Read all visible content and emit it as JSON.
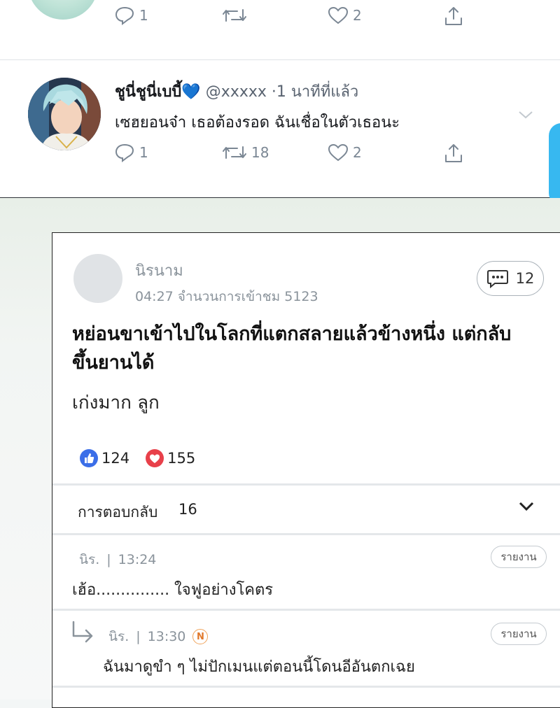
{
  "tweets": [
    {
      "actions": {
        "reply": "1",
        "retweet": "",
        "like": "2"
      }
    },
    {
      "name": "ชูนี่ชูนี่เบบี้",
      "heart": "💙",
      "meta": "@xxxxx ·1 นาทีที่แล้ว",
      "text": "เซฮยอนจ๋า เธอต้องรอด ฉันเชื่อในตัวเธอนะ",
      "actions": {
        "reply": "1",
        "retweet": "18",
        "like": "2"
      }
    }
  ],
  "post": {
    "username": "นิรนาม",
    "meta": "04:27 จำนวนการเข้าชม 5123",
    "comment_count": "12",
    "title": "หย่อนขาเข้าไปในโลกที่แตกสลายแล้วข้างหนึ่ง แต่กลับขึ้นยานได้",
    "body": "เก่งมาก ลูก",
    "likes": "124",
    "hearts": "155",
    "replies_label": "การตอบกลับ",
    "replies_count": "16"
  },
  "comments": [
    {
      "user": "นิร.",
      "sep": "|",
      "time": "13:24",
      "text": "เฮ้อ............... ใจฟูอย่างโคตร",
      "report": "รายงาน"
    },
    {
      "user": "นิร.",
      "sep": "|",
      "time": "13:30",
      "badge": "N",
      "text": "ฉันมาดูขำ ๆ ไม่ปักเมนแต่ตอนนี้โดนอีอันตกเฉย",
      "report": "รายงาน"
    }
  ],
  "colors": {
    "icon_gray": "#7b8794",
    "like_blue": "#3b6ee8",
    "heart_red": "#e8404a",
    "badge_orange": "#e0782a"
  }
}
